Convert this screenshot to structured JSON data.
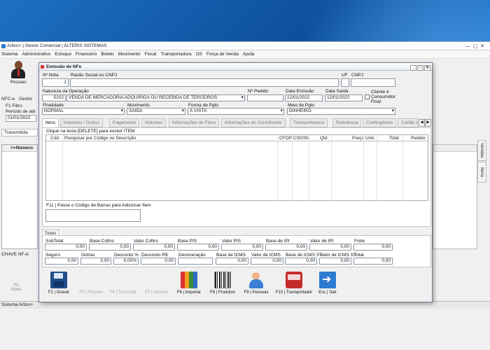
{
  "app": {
    "title": "Artico+ | Gestor Comercial | ALTERIS SISTEMAS",
    "menu": [
      "Sistema",
      "Administrativo",
      "Estoque",
      "Financeiro",
      "Boleto",
      "Movimento",
      "Fiscal",
      "Transportadora",
      "OS",
      "Força de Venda",
      "Ajuda"
    ],
    "pessoas_label": "Pessoas",
    "nfce_label": "NFC-e",
    "gestor_label": "Gestor",
    "filtro_label": "F1 Filtro",
    "periodo_label": "Período de  até",
    "periodo_value": "01/01/2022",
    "transmitida_tab": "Transmitida",
    "bg_grid_header": ">>Número",
    "chave_label": "CHAVE NF-e:",
    "p2_label": "F2",
    "p2_sub": "Novo",
    "status_text": "Sistema Artico+",
    "vertical_tabs": [
      "Vendas",
      "Itens"
    ]
  },
  "dialog": {
    "title": "Emissão de NFe",
    "header": {
      "nnota_label": "Nº Nota",
      "nnota_value": "1",
      "razao_label": "Razão Social ou CNPJ",
      "razao_value": "",
      "uf_label": "UF",
      "cnpj_label": "CNPJ",
      "natureza_label": "Natureza da Operação",
      "natureza_code": "5102",
      "natureza_value": "VENDA DE MERCADORIA ADQUIRIDA OU RECEBIDA DE TERCEIROS",
      "pedido_label": "Nº Pedido",
      "emissao_label": "Data Emissão",
      "emissao_value": "12/01/2022",
      "saida_label": "Data Saída",
      "saida_value": "12/01/2022",
      "cliente_final_label": "Cliente é Consumidor Final",
      "finalidade_label": "Finalidade",
      "finalidade_value": "NORMAL",
      "movimento_label": "Movimento",
      "movimento_value": "SAÍDA",
      "forma_label": "Forma de Pgto",
      "forma_value": "À VISTA",
      "meio_label": "Meio de Pgto",
      "meio_value": "DINHEIRO"
    },
    "tabs": [
      "Itens",
      "Impostos / Outros",
      "Pagamento",
      "Volumes",
      "Informações do Fisco",
      "Informações do Contribuinte",
      "Transportadora",
      "Referência",
      "Contingência",
      "Cartão d"
    ],
    "items": {
      "hint": "Clique na tecla [DELETE] para excluir ITEM",
      "columns": [
        "Cód.",
        "Pesquisar por Código ou Descrição",
        "CFOP",
        "CSOSN",
        "Qtd.",
        "Preço",
        "Und.",
        "Total",
        "Pedido"
      ],
      "barcode_label": "F11 | Passe o Código de Barras para Adicionar Item"
    },
    "totais": {
      "tab_label": "Totais",
      "row1": [
        {
          "label": "SubTotal",
          "value": "0,00"
        },
        {
          "label": "Base Cofins",
          "value": "0,00"
        },
        {
          "label": "Valor Cofins",
          "value": "0,00"
        },
        {
          "label": "Base PIS",
          "value": "0,00"
        },
        {
          "label": "Valor PIS",
          "value": "0,00"
        },
        {
          "label": "Base de IPI",
          "value": "0,00"
        },
        {
          "label": "Valor de IPI",
          "value": "0,00"
        },
        {
          "label": "Frete",
          "value": "0,00"
        }
      ],
      "row2": [
        {
          "label": "Seguro",
          "value": "0,00"
        },
        {
          "label": "Outras",
          "value": "0,00"
        },
        {
          "label": "Desconto %",
          "value": "0,00%"
        },
        {
          "label": "Desconto R$",
          "value": "0,00"
        },
        {
          "label": "Desoneração",
          "value": ""
        },
        {
          "label": "Base de ICMS",
          "value": "0,00"
        },
        {
          "label": "Valor de ICMS",
          "value": "0,00"
        },
        {
          "label": "Base de ICMS ST",
          "value": "0,00"
        },
        {
          "label": "Valor de ICMS ST",
          "value": "0,00"
        },
        {
          "label": "Total",
          "value": "0,00"
        }
      ]
    },
    "toolbar": [
      {
        "label": "F2 | Gravar",
        "icon": "floppy-disk-icon",
        "enabled": true
      },
      {
        "label": "F3 | Preview",
        "icon": "preview-icon",
        "enabled": false
      },
      {
        "label": "F4 | Transmitir",
        "icon": "transmit-icon",
        "enabled": false
      },
      {
        "label": "F5 | Imprimir",
        "icon": "print-icon",
        "enabled": false
      },
      {
        "label": "F6 | Importar",
        "icon": "books-icon",
        "enabled": true
      },
      {
        "label": "F8 | Produtos",
        "icon": "barcode-icon",
        "enabled": true
      },
      {
        "label": "F9 | Pessoas",
        "icon": "people-icon",
        "enabled": true
      },
      {
        "label": "F10 | Transportador",
        "icon": "truck-icon",
        "enabled": true
      },
      {
        "label": "Esc | Sair",
        "icon": "exit-icon",
        "enabled": true
      }
    ]
  }
}
